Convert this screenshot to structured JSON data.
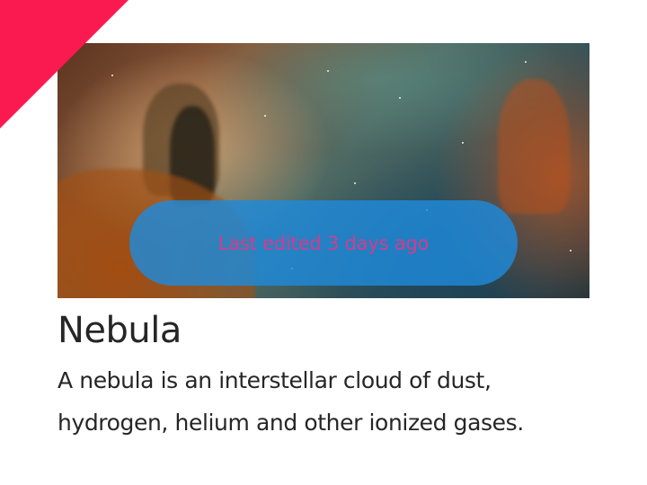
{
  "ribbon": {
    "color": "#fb1a4f"
  },
  "card": {
    "image_alt": "Nebula image",
    "status_text": "Last edited 3 days ago",
    "title": "Nebula",
    "description": "A nebula is an interstellar cloud of dust, hydrogen, helium and other ionized gases."
  },
  "colors": {
    "pill_background": "#1e8ada",
    "pill_text": "#d63b8c",
    "text": "#262626"
  }
}
